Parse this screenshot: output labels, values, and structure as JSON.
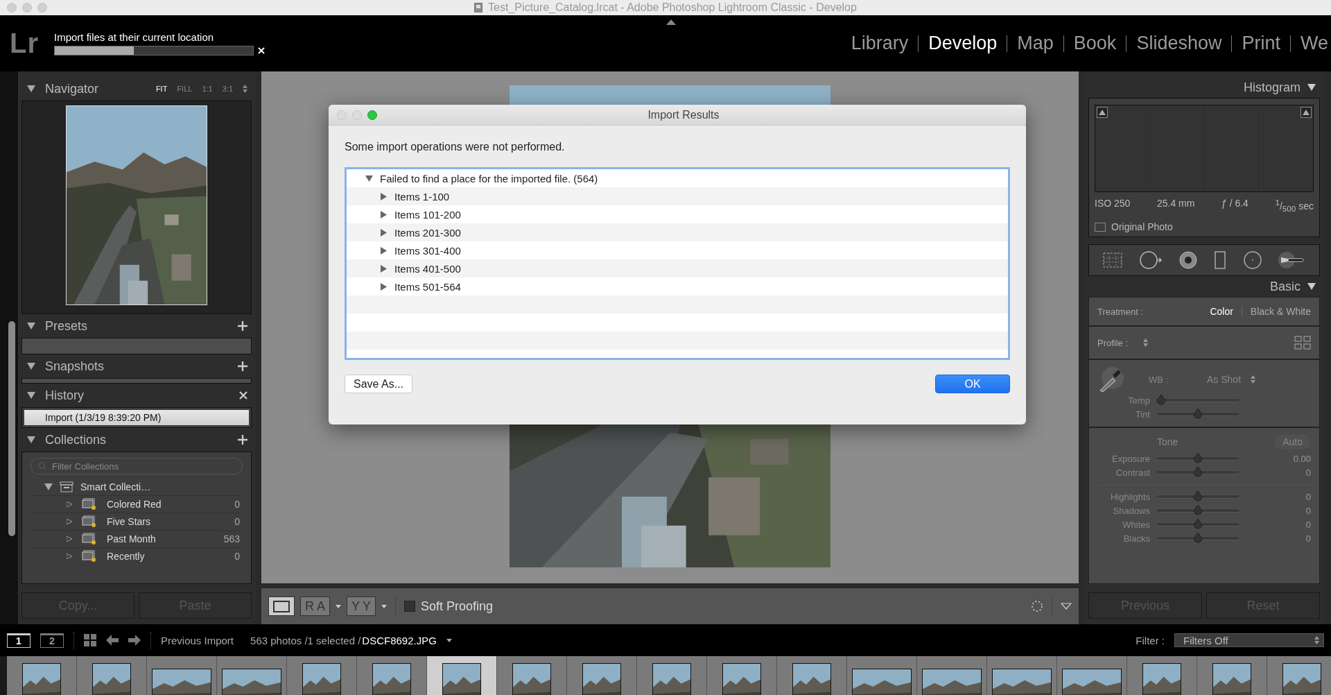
{
  "window": {
    "title": "Test_Picture_Catalog.lrcat - Adobe Photoshop Lightroom Classic - Develop"
  },
  "top_bar": {
    "logo": "Lr",
    "task": "Import files at their current location",
    "progress": {
      "level": 0.4
    }
  },
  "modules": [
    {
      "label": "Library",
      "selected": false
    },
    {
      "label": "Develop",
      "selected": true
    },
    {
      "label": "Map",
      "selected": false
    },
    {
      "label": "Book",
      "selected": false
    },
    {
      "label": "Slideshow",
      "selected": false
    },
    {
      "label": "Print",
      "selected": false
    },
    {
      "label": "We",
      "selected": false
    }
  ],
  "navigator": {
    "title": "Navigator",
    "zoom_options": [
      {
        "label": "FIT",
        "selected": true
      },
      {
        "label": "FILL",
        "selected": false
      },
      {
        "label": "1:1",
        "selected": false
      },
      {
        "label": "3:1",
        "selected": false
      }
    ]
  },
  "presets": {
    "title": "Presets"
  },
  "snapshots": {
    "title": "Snapshots"
  },
  "history": {
    "title": "History",
    "items": [
      {
        "label": "Import (1/3/19 8:39:20 PM)",
        "selected": true
      }
    ]
  },
  "collections": {
    "title": "Collections",
    "filter": {
      "placeholder": "Filter Collections"
    },
    "tree": [
      {
        "label": "Smart Collecti…",
        "expanded": true,
        "children": [
          {
            "label": "Colored Red",
            "count": "0"
          },
          {
            "label": "Five Stars",
            "count": "0"
          },
          {
            "label": "Past Month",
            "count": "563"
          },
          {
            "label": "Recently",
            "count": "0"
          }
        ]
      }
    ]
  },
  "left_buttons": [
    "Copy...",
    "Paste"
  ],
  "toolbar": {
    "before_after": "RA",
    "compare": "YY",
    "soft_proofing": {
      "label": "Soft Proofing",
      "checked": false
    }
  },
  "dialog": {
    "title": "Import Results",
    "message": "Some import operations were not performed.",
    "tree": {
      "label": "Failed to find a place for the imported file. (564)",
      "expanded": true,
      "children": [
        {
          "label": "Items 1-100",
          "expanded": false
        },
        {
          "label": "Items 101-200",
          "expanded": false
        },
        {
          "label": "Items 201-300",
          "expanded": false
        },
        {
          "label": "Items 301-400",
          "expanded": false
        },
        {
          "label": "Items 401-500",
          "expanded": false
        },
        {
          "label": "Items 501-564",
          "expanded": false
        }
      ]
    },
    "buttons": [
      {
        "label": "Save As...",
        "default": false
      },
      {
        "label": "OK",
        "default": true
      }
    ]
  },
  "histogram": {
    "title": "Histogram",
    "info": [
      "ISO 250",
      "25.4 mm",
      "ƒ / 6.4",
      "$^{1}$/$_{500}$ sec"
    ],
    "original_photo": {
      "label": "Original Photo",
      "checked": false
    }
  },
  "basic": {
    "title": "Basic",
    "treatment": {
      "label": "Treatment :",
      "options": [
        {
          "label": "Color",
          "selected": true
        },
        {
          "label": "Black & White",
          "selected": false
        }
      ]
    },
    "profile": {
      "label": "Profile :"
    },
    "wb": {
      "label": "WB :",
      "value": "As Shot"
    },
    "wb_sliders": [
      {
        "name": "Temp",
        "level": 0.05
      },
      {
        "name": "Tint",
        "level": 0.5
      }
    ],
    "tone": {
      "label": "Tone",
      "auto": "Auto"
    },
    "tone_sliders": [
      {
        "name": "Exposure",
        "level": 0.5,
        "value": "0.00"
      },
      {
        "name": "Contrast",
        "level": 0.5,
        "value": "0"
      }
    ],
    "presence_sliders": [
      {
        "name": "Highlights",
        "level": 0.5,
        "value": "0"
      },
      {
        "name": "Shadows",
        "level": 0.5,
        "value": "0"
      },
      {
        "name": "Whites",
        "level": 0.5,
        "value": "0"
      },
      {
        "name": "Blacks",
        "level": 0.5,
        "value": "0"
      }
    ]
  },
  "right_buttons": [
    "Previous",
    "Reset"
  ],
  "filmstrip_bar": {
    "views": [
      {
        "label": "1",
        "selected": true
      },
      {
        "label": "2",
        "selected": false
      }
    ],
    "source": "Previous Import",
    "count": "563 photos /1 selected /",
    "filename": "DSCF8692.JPG",
    "filter_label": "Filter :",
    "filter_value": "Filters Off"
  },
  "filmstrip": [
    {
      "kind": "portrait",
      "selected": false
    },
    {
      "kind": "portrait",
      "selected": false
    },
    {
      "kind": "landscape",
      "selected": false
    },
    {
      "kind": "landscape",
      "selected": false
    },
    {
      "kind": "portrait",
      "selected": false
    },
    {
      "kind": "portrait",
      "selected": false
    },
    {
      "kind": "portrait",
      "selected": true
    },
    {
      "kind": "portrait",
      "selected": false
    },
    {
      "kind": "portrait",
      "selected": false
    },
    {
      "kind": "portrait",
      "selected": false
    },
    {
      "kind": "portrait",
      "selected": false
    },
    {
      "kind": "portrait",
      "selected": false
    },
    {
      "kind": "landscape",
      "selected": false
    },
    {
      "kind": "landscape",
      "selected": false
    },
    {
      "kind": "landscape",
      "selected": false
    },
    {
      "kind": "landscape",
      "selected": false
    },
    {
      "kind": "portrait",
      "selected": false
    },
    {
      "kind": "portrait",
      "selected": false
    },
    {
      "kind": "portrait",
      "selected": false
    }
  ]
}
